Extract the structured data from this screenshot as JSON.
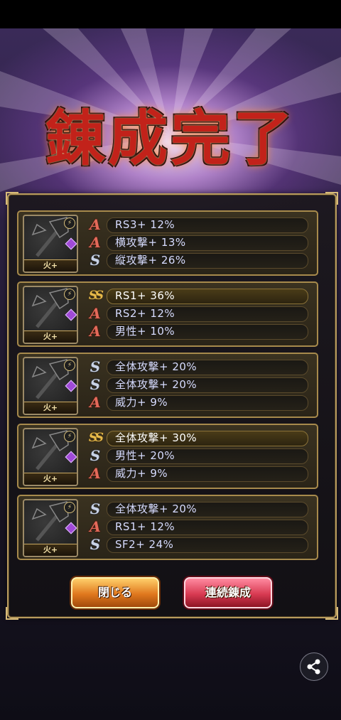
{
  "title": "錬成完了",
  "cards": [
    {
      "tag": "火+",
      "rows": [
        {
          "icon": "A",
          "text": "RS3+ 12%"
        },
        {
          "icon": "A",
          "text": "横攻撃+ 13%"
        },
        {
          "icon": "S",
          "text": "縦攻撃+ 26%"
        }
      ]
    },
    {
      "tag": "火+",
      "rows": [
        {
          "icon": "SS",
          "text": "RS1+ 36%"
        },
        {
          "icon": "A",
          "text": "RS2+ 12%"
        },
        {
          "icon": "A",
          "text": "男性+ 10%"
        }
      ]
    },
    {
      "tag": "火+",
      "rows": [
        {
          "icon": "S",
          "text": "全体攻撃+ 20%"
        },
        {
          "icon": "S",
          "text": "全体攻撃+ 20%"
        },
        {
          "icon": "A",
          "text": "威力+ 9%"
        }
      ]
    },
    {
      "tag": "火+",
      "rows": [
        {
          "icon": "SS",
          "text": "全体攻撃+ 30%"
        },
        {
          "icon": "S",
          "text": "男性+ 20%"
        },
        {
          "icon": "A",
          "text": "威力+ 9%"
        }
      ]
    },
    {
      "tag": "火+",
      "rows": [
        {
          "icon": "S",
          "text": "全体攻撃+ 20%"
        },
        {
          "icon": "A",
          "text": "RS1+ 12%"
        },
        {
          "icon": "S",
          "text": "SF2+ 24%"
        }
      ]
    }
  ],
  "buttons": {
    "close": "閉じる",
    "continuous": "連続錬成"
  },
  "icons": {
    "rank_A": "A-rank-icon",
    "rank_S": "S-rank-icon",
    "rank_SS": "SS-rank-icon",
    "share": "share-icon"
  }
}
